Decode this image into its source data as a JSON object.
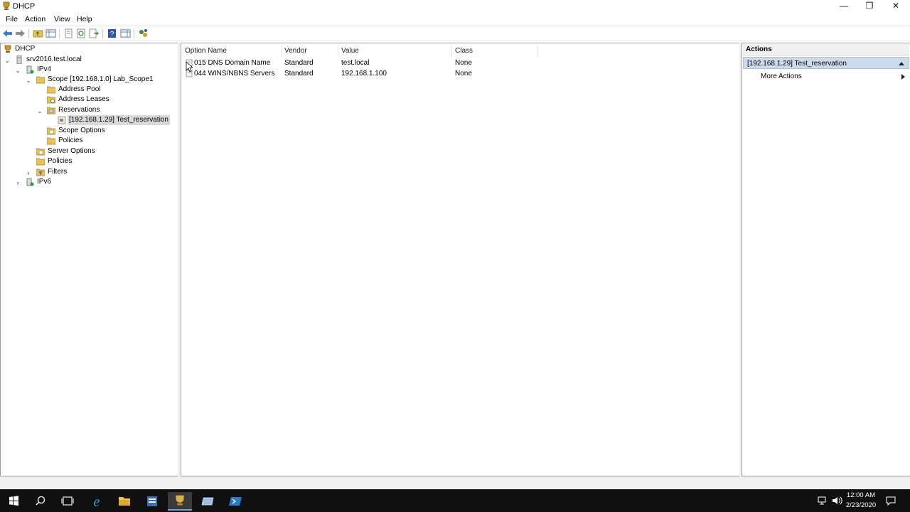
{
  "window": {
    "title": "DHCP",
    "minimize": "—",
    "restore": "❐",
    "close": "✕"
  },
  "menu": [
    "File",
    "Action",
    "View",
    "Help"
  ],
  "tree": {
    "root": "DHCP",
    "server": "srv2016.test.local",
    "ipv4": "IPv4",
    "scope": "Scope [192.168.1.0] Lab_Scope1",
    "address_pool": "Address Pool",
    "address_leases": "Address Leases",
    "reservations": "Reservations",
    "reservation_item": "[192.168.1.29] Test_reservation",
    "scope_options": "Scope Options",
    "scope_policies": "Policies",
    "server_options": "Server Options",
    "policies": "Policies",
    "filters": "Filters",
    "ipv6": "IPv6"
  },
  "list": {
    "columns": [
      "Option Name",
      "Vendor",
      "Value",
      "Class"
    ],
    "rows": [
      {
        "option": "015 DNS Domain Name",
        "vendor": "Standard",
        "value": "test.local",
        "class": "None"
      },
      {
        "option": "044 WINS/NBNS Servers",
        "vendor": "Standard",
        "value": "192.168.1.100",
        "class": "None"
      }
    ]
  },
  "actions": {
    "header": "Actions",
    "selected": "[192.168.1.29] Test_reservation",
    "more": "More Actions"
  },
  "taskbar": {
    "time": "12:00 AM",
    "date": "2/23/2020"
  },
  "colors": {
    "selection": "#cddced",
    "taskbar": "#101010"
  }
}
